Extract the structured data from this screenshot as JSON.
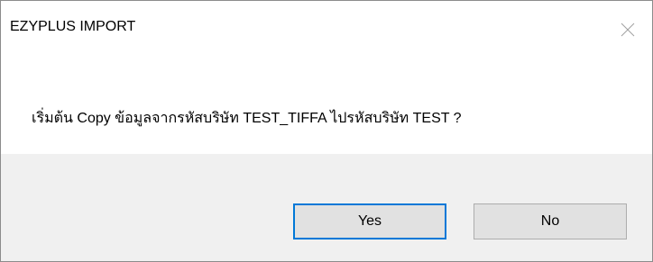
{
  "window": {
    "title": "EZYPLUS IMPORT",
    "close_icon": "close-icon"
  },
  "message": "เริ่มต้น Copy ข้อมูลจากรหัสบริษัท TEST_TIFFA ไปรหัสบริษัท TEST ?",
  "buttons": {
    "yes_label": "Yes",
    "no_label": "No"
  },
  "colors": {
    "footer_background": "#f0f0f0",
    "button_background": "#e1e1e1",
    "focus_border": "#0078d7",
    "close_icon": "#a0a0a0"
  }
}
